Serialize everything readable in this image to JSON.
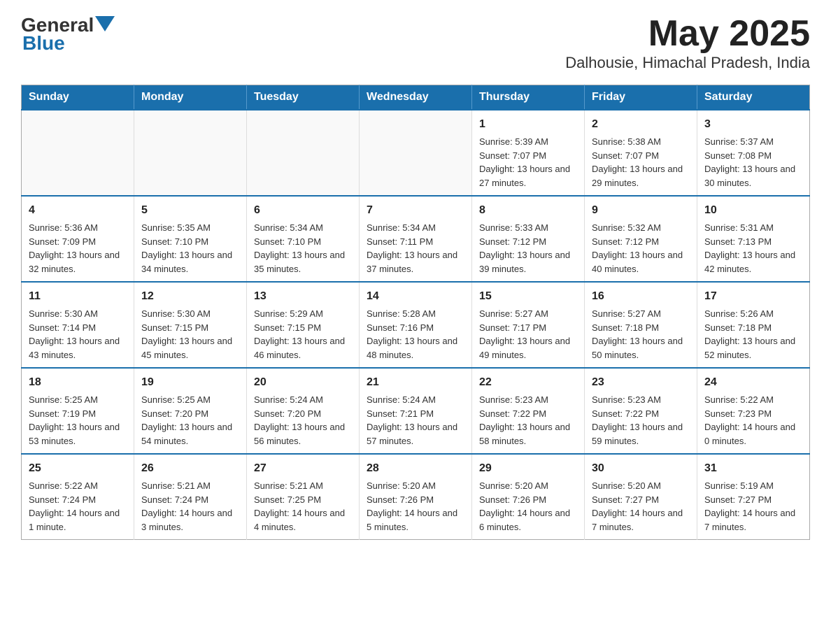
{
  "header": {
    "logo": {
      "general": "General",
      "blue": "Blue"
    },
    "title": "May 2025",
    "subtitle": "Dalhousie, Himachal Pradesh, India"
  },
  "weekdays": [
    "Sunday",
    "Monday",
    "Tuesday",
    "Wednesday",
    "Thursday",
    "Friday",
    "Saturday"
  ],
  "weeks": [
    [
      {
        "day": "",
        "info": ""
      },
      {
        "day": "",
        "info": ""
      },
      {
        "day": "",
        "info": ""
      },
      {
        "day": "",
        "info": ""
      },
      {
        "day": "1",
        "info": "Sunrise: 5:39 AM\nSunset: 7:07 PM\nDaylight: 13 hours and 27 minutes."
      },
      {
        "day": "2",
        "info": "Sunrise: 5:38 AM\nSunset: 7:07 PM\nDaylight: 13 hours and 29 minutes."
      },
      {
        "day": "3",
        "info": "Sunrise: 5:37 AM\nSunset: 7:08 PM\nDaylight: 13 hours and 30 minutes."
      }
    ],
    [
      {
        "day": "4",
        "info": "Sunrise: 5:36 AM\nSunset: 7:09 PM\nDaylight: 13 hours and 32 minutes."
      },
      {
        "day": "5",
        "info": "Sunrise: 5:35 AM\nSunset: 7:10 PM\nDaylight: 13 hours and 34 minutes."
      },
      {
        "day": "6",
        "info": "Sunrise: 5:34 AM\nSunset: 7:10 PM\nDaylight: 13 hours and 35 minutes."
      },
      {
        "day": "7",
        "info": "Sunrise: 5:34 AM\nSunset: 7:11 PM\nDaylight: 13 hours and 37 minutes."
      },
      {
        "day": "8",
        "info": "Sunrise: 5:33 AM\nSunset: 7:12 PM\nDaylight: 13 hours and 39 minutes."
      },
      {
        "day": "9",
        "info": "Sunrise: 5:32 AM\nSunset: 7:12 PM\nDaylight: 13 hours and 40 minutes."
      },
      {
        "day": "10",
        "info": "Sunrise: 5:31 AM\nSunset: 7:13 PM\nDaylight: 13 hours and 42 minutes."
      }
    ],
    [
      {
        "day": "11",
        "info": "Sunrise: 5:30 AM\nSunset: 7:14 PM\nDaylight: 13 hours and 43 minutes."
      },
      {
        "day": "12",
        "info": "Sunrise: 5:30 AM\nSunset: 7:15 PM\nDaylight: 13 hours and 45 minutes."
      },
      {
        "day": "13",
        "info": "Sunrise: 5:29 AM\nSunset: 7:15 PM\nDaylight: 13 hours and 46 minutes."
      },
      {
        "day": "14",
        "info": "Sunrise: 5:28 AM\nSunset: 7:16 PM\nDaylight: 13 hours and 48 minutes."
      },
      {
        "day": "15",
        "info": "Sunrise: 5:27 AM\nSunset: 7:17 PM\nDaylight: 13 hours and 49 minutes."
      },
      {
        "day": "16",
        "info": "Sunrise: 5:27 AM\nSunset: 7:18 PM\nDaylight: 13 hours and 50 minutes."
      },
      {
        "day": "17",
        "info": "Sunrise: 5:26 AM\nSunset: 7:18 PM\nDaylight: 13 hours and 52 minutes."
      }
    ],
    [
      {
        "day": "18",
        "info": "Sunrise: 5:25 AM\nSunset: 7:19 PM\nDaylight: 13 hours and 53 minutes."
      },
      {
        "day": "19",
        "info": "Sunrise: 5:25 AM\nSunset: 7:20 PM\nDaylight: 13 hours and 54 minutes."
      },
      {
        "day": "20",
        "info": "Sunrise: 5:24 AM\nSunset: 7:20 PM\nDaylight: 13 hours and 56 minutes."
      },
      {
        "day": "21",
        "info": "Sunrise: 5:24 AM\nSunset: 7:21 PM\nDaylight: 13 hours and 57 minutes."
      },
      {
        "day": "22",
        "info": "Sunrise: 5:23 AM\nSunset: 7:22 PM\nDaylight: 13 hours and 58 minutes."
      },
      {
        "day": "23",
        "info": "Sunrise: 5:23 AM\nSunset: 7:22 PM\nDaylight: 13 hours and 59 minutes."
      },
      {
        "day": "24",
        "info": "Sunrise: 5:22 AM\nSunset: 7:23 PM\nDaylight: 14 hours and 0 minutes."
      }
    ],
    [
      {
        "day": "25",
        "info": "Sunrise: 5:22 AM\nSunset: 7:24 PM\nDaylight: 14 hours and 1 minute."
      },
      {
        "day": "26",
        "info": "Sunrise: 5:21 AM\nSunset: 7:24 PM\nDaylight: 14 hours and 3 minutes."
      },
      {
        "day": "27",
        "info": "Sunrise: 5:21 AM\nSunset: 7:25 PM\nDaylight: 14 hours and 4 minutes."
      },
      {
        "day": "28",
        "info": "Sunrise: 5:20 AM\nSunset: 7:26 PM\nDaylight: 14 hours and 5 minutes."
      },
      {
        "day": "29",
        "info": "Sunrise: 5:20 AM\nSunset: 7:26 PM\nDaylight: 14 hours and 6 minutes."
      },
      {
        "day": "30",
        "info": "Sunrise: 5:20 AM\nSunset: 7:27 PM\nDaylight: 14 hours and 7 minutes."
      },
      {
        "day": "31",
        "info": "Sunrise: 5:19 AM\nSunset: 7:27 PM\nDaylight: 14 hours and 7 minutes."
      }
    ]
  ]
}
